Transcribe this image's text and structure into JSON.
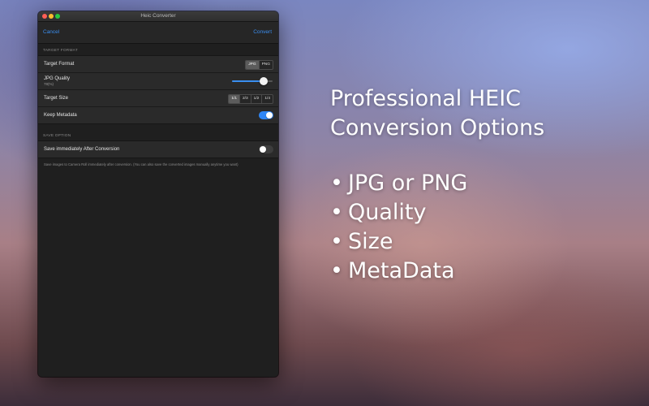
{
  "window": {
    "title": "Heic Converter"
  },
  "navbar": {
    "cancel_label": "Cancel",
    "convert_label": "Convert"
  },
  "target_format_section": {
    "header": "TARGET FORMAT",
    "format_row": {
      "label": "Target Format",
      "options": [
        "JPG",
        "PNG"
      ],
      "selected": "JPG"
    },
    "quality_row": {
      "label": "JPG Quality",
      "value_text": "78(%)",
      "value_percent": 78
    },
    "size_row": {
      "label": "Target Size",
      "options": [
        "1/1",
        "2/3",
        "1/2",
        "1/4"
      ],
      "selected": "1/1"
    },
    "metadata_row": {
      "label": "Keep Metadata",
      "enabled": true
    }
  },
  "save_option_section": {
    "header": "SAVE OPTION",
    "save_row": {
      "label": "Save immediately After Conversion",
      "enabled": false
    },
    "footnote": "Save images to Camera Roll immediately after conversion. (You can also save the converted images manually anytime you want)"
  },
  "promo": {
    "heading_line1": "Professional HEIC",
    "heading_line2": "Conversion Options",
    "bullet_symbol": "•",
    "items": [
      "JPG or PNG",
      "Quality",
      "Size",
      "MetaData"
    ]
  },
  "colors": {
    "accent": "#3a8ef0",
    "toggle_on": "#2f86f6",
    "window_bg": "#1f1f1f",
    "row_bg": "#2a2a2a"
  },
  "icons": [
    "close-icon",
    "minimize-icon",
    "maximize-icon"
  ]
}
